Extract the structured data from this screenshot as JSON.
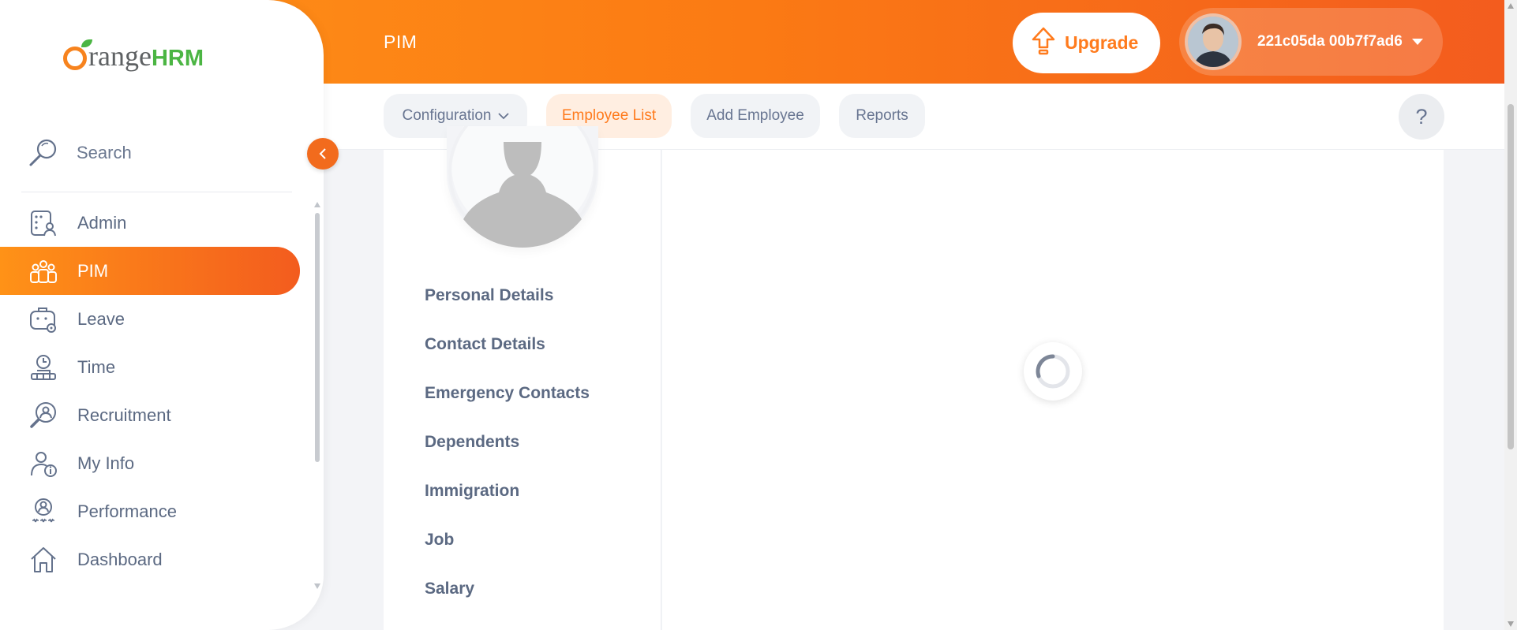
{
  "header": {
    "title": "PIM",
    "upgrade_label": "Upgrade",
    "user_name": "221c05da 00b7f7ad6"
  },
  "subnav": {
    "tabs": [
      {
        "label": "Configuration"
      },
      {
        "label": "Employee List"
      },
      {
        "label": "Add Employee"
      },
      {
        "label": "Reports"
      }
    ],
    "help_label": "?"
  },
  "sidebar": {
    "logo_text": "range",
    "logo_suffix": "HRM",
    "search_label": "Search",
    "items": [
      {
        "label": "Admin",
        "icon": "admin-icon"
      },
      {
        "label": "PIM",
        "icon": "pim-icon"
      },
      {
        "label": "Leave",
        "icon": "leave-icon"
      },
      {
        "label": "Time",
        "icon": "time-icon"
      },
      {
        "label": "Recruitment",
        "icon": "recruitment-icon"
      },
      {
        "label": "My Info",
        "icon": "my-info-icon"
      },
      {
        "label": "Performance",
        "icon": "performance-icon"
      },
      {
        "label": "Dashboard",
        "icon": "dashboard-icon"
      }
    ]
  },
  "profile_menu": [
    "Personal Details",
    "Contact Details",
    "Emergency Contacts",
    "Dependents",
    "Immigration",
    "Job",
    "Salary"
  ],
  "colors": {
    "accent": "#ff7b1d",
    "active_gradient_start": "#ff9217",
    "active_gradient_end": "#f35c1e"
  }
}
